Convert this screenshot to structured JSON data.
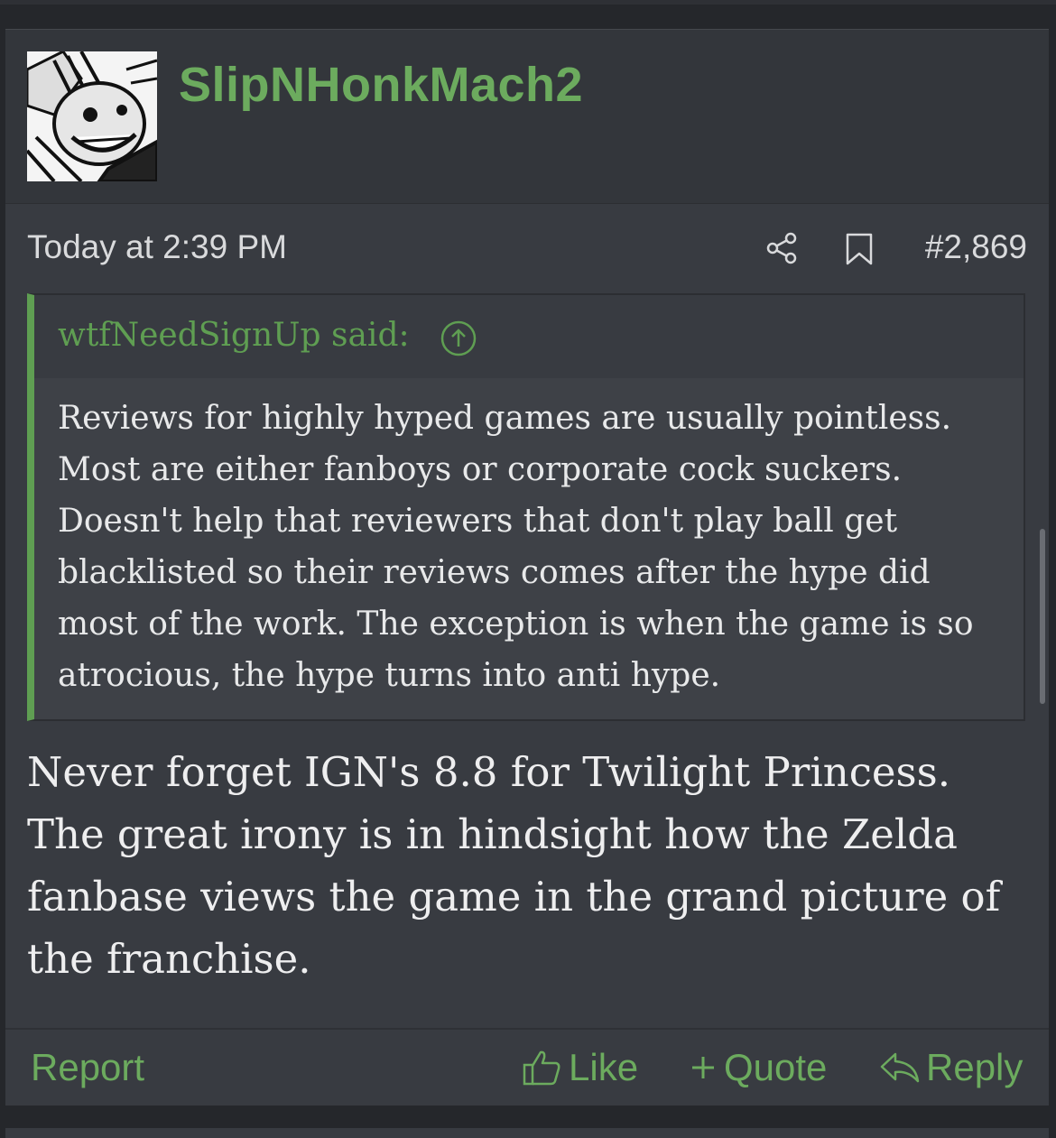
{
  "post": {
    "username": "SlipNHonkMach2",
    "timestamp": "Today at 2:39 PM",
    "post_number": "#2,869",
    "quote": {
      "author": "wtfNeedSignUp said:",
      "text": "Reviews for highly hyped games are usually pointless. Most are either fanboys or corporate cock suckers. Doesn't help that reviewers that don't play ball get blacklisted so their reviews comes after the hype did most of the work. The exception is when the game is so atrocious, the hype turns into anti hype."
    },
    "message": "Never forget IGN's 8.8 for Twilight Princess. The great irony is in hindsight how the Zelda fanbase views the game in the grand picture of the franchise.",
    "actions": {
      "report": "Report",
      "like": "Like",
      "quote": "Quote",
      "reply": "Reply"
    }
  },
  "colors": {
    "accent": "#6cab5e",
    "background": "#383b41"
  }
}
